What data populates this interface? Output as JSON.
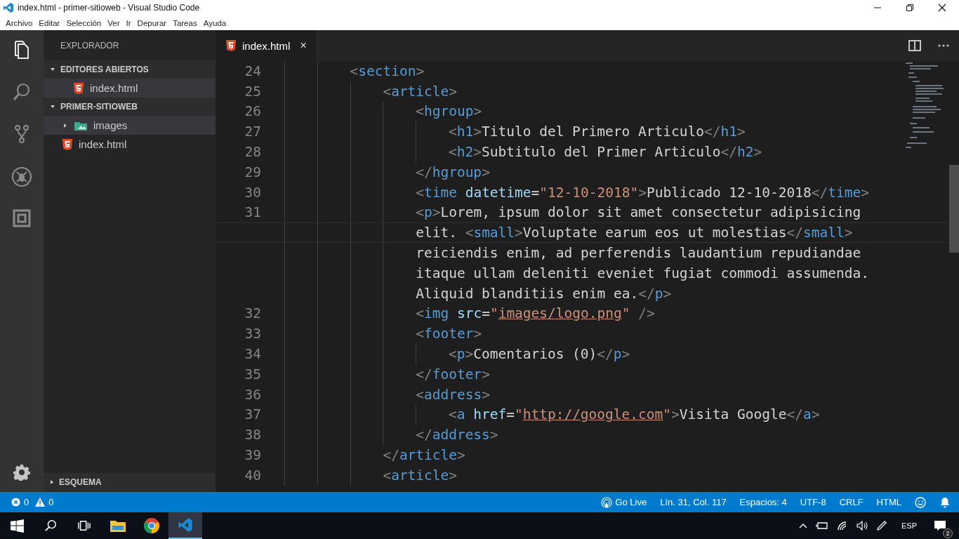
{
  "window": {
    "title": "index.html - primer-sitioweb - Visual Studio Code"
  },
  "menu": [
    "Archivo",
    "Editar",
    "Selección",
    "Ver",
    "Ir",
    "Depurar",
    "Tareas",
    "Ayuda"
  ],
  "activity_bar": [
    {
      "kind": "files",
      "selected": true
    },
    {
      "kind": "search",
      "selected": false
    },
    {
      "kind": "source-control",
      "selected": false
    },
    {
      "kind": "debug",
      "selected": false
    },
    {
      "kind": "extensions",
      "selected": false
    }
  ],
  "sidebar": {
    "title": "EXPLORADOR",
    "sections": [
      {
        "label": "EDITORES ABIERTOS",
        "expanded": true,
        "items": [
          {
            "kind": "html",
            "label": "index.html",
            "selected": true
          }
        ]
      },
      {
        "label": "PRIMER-SITIOWEB",
        "expanded": true,
        "items": [
          {
            "kind": "folder",
            "label": "images",
            "expanded": false,
            "selected": true
          },
          {
            "kind": "html",
            "label": "index.html",
            "selected": false
          }
        ]
      }
    ],
    "outline": {
      "label": "ESQUEMA",
      "expanded": false
    }
  },
  "tabs": [
    {
      "label": "index.html",
      "selected": true,
      "close": "×"
    }
  ],
  "code": {
    "lines": [
      {
        "number": "24",
        "rows": [
          {
            "current": false,
            "tokens": [
              {
                "kind": "punct",
                "text": "<"
              },
              {
                "kind": "tag",
                "text": "section"
              },
              {
                "kind": "punct",
                "text": ">"
              }
            ]
          }
        ],
        "children": [
          {
            "number": "25",
            "rows": [
              {
                "current": false,
                "tokens": [
                  {
                    "kind": "punct",
                    "text": "<"
                  },
                  {
                    "kind": "tag",
                    "text": "article"
                  },
                  {
                    "kind": "punct",
                    "text": ">"
                  }
                ]
              }
            ],
            "children": [
              {
                "number": "26",
                "rows": [
                  {
                    "current": false,
                    "tokens": [
                      {
                        "kind": "punct",
                        "text": "<"
                      },
                      {
                        "kind": "tag",
                        "text": "hgroup"
                      },
                      {
                        "kind": "punct",
                        "text": ">"
                      }
                    ]
                  }
                ],
                "children": [
                  {
                    "number": "27",
                    "rows": [
                      {
                        "current": false,
                        "tokens": [
                          {
                            "kind": "punct",
                            "text": "<"
                          },
                          {
                            "kind": "tag",
                            "text": "h1"
                          },
                          {
                            "kind": "punct",
                            "text": ">"
                          },
                          {
                            "kind": "text",
                            "text": "Titulo del Primero Articulo"
                          },
                          {
                            "kind": "punct",
                            "text": "</"
                          },
                          {
                            "kind": "tag",
                            "text": "h1"
                          },
                          {
                            "kind": "punct",
                            "text": ">"
                          }
                        ]
                      }
                    ]
                  },
                  {
                    "number": "28",
                    "rows": [
                      {
                        "current": false,
                        "tokens": [
                          {
                            "kind": "punct",
                            "text": "<"
                          },
                          {
                            "kind": "tag",
                            "text": "h2"
                          },
                          {
                            "kind": "punct",
                            "text": ">"
                          },
                          {
                            "kind": "text",
                            "text": "Subtitulo del Primer Articulo"
                          },
                          {
                            "kind": "punct",
                            "text": "</"
                          },
                          {
                            "kind": "tag",
                            "text": "h2"
                          },
                          {
                            "kind": "punct",
                            "text": ">"
                          }
                        ]
                      }
                    ]
                  }
                ]
              },
              {
                "number": "29",
                "rows": [
                  {
                    "current": false,
                    "tokens": [
                      {
                        "kind": "punct",
                        "text": "</"
                      },
                      {
                        "kind": "tag",
                        "text": "hgroup"
                      },
                      {
                        "kind": "punct",
                        "text": ">"
                      }
                    ]
                  }
                ]
              },
              {
                "number": "30",
                "rows": [
                  {
                    "current": false,
                    "tokens": [
                      {
                        "kind": "punct",
                        "text": "<"
                      },
                      {
                        "kind": "tag",
                        "text": "time"
                      },
                      {
                        "kind": "attr",
                        "text": " datetime"
                      },
                      {
                        "kind": "text",
                        "text": "="
                      },
                      {
                        "kind": "string",
                        "text": "\"12-10-2018\""
                      },
                      {
                        "kind": "punct",
                        "text": ">"
                      },
                      {
                        "kind": "text",
                        "text": "Publicado 12-10-2018"
                      },
                      {
                        "kind": "punct",
                        "text": "</"
                      },
                      {
                        "kind": "tag",
                        "text": "time"
                      },
                      {
                        "kind": "punct",
                        "text": ">"
                      }
                    ]
                  }
                ]
              },
              {
                "number": "31",
                "rows": [
                  {
                    "current": false,
                    "tokens": [
                      {
                        "kind": "punct",
                        "text": "<"
                      },
                      {
                        "kind": "tag",
                        "text": "p"
                      },
                      {
                        "kind": "punct",
                        "text": ">"
                      },
                      {
                        "kind": "text",
                        "text": "Lorem, ipsum dolor sit amet consectetur adipisicing"
                      }
                    ]
                  },
                  {
                    "current": true,
                    "tokens": [
                      {
                        "kind": "text",
                        "text": "elit. "
                      },
                      {
                        "kind": "punct",
                        "text": "<"
                      },
                      {
                        "kind": "tag",
                        "text": "small"
                      },
                      {
                        "kind": "punct",
                        "text": ">"
                      },
                      {
                        "kind": "text",
                        "text": "Voluptate earum eos ut molestias"
                      },
                      {
                        "kind": "punct",
                        "text": "</"
                      },
                      {
                        "kind": "tag",
                        "text": "small"
                      },
                      {
                        "kind": "punct",
                        "text": ">"
                      }
                    ]
                  },
                  {
                    "current": false,
                    "tokens": [
                      {
                        "kind": "text",
                        "text": "reiciendis enim, ad perferendis laudantium repudiandae"
                      }
                    ]
                  },
                  {
                    "current": false,
                    "tokens": [
                      {
                        "kind": "text",
                        "text": "itaque ullam deleniti eveniet fugiat commodi assumenda."
                      }
                    ]
                  },
                  {
                    "current": false,
                    "tokens": [
                      {
                        "kind": "text",
                        "text": "Aliquid blanditiis enim ea."
                      },
                      {
                        "kind": "punct",
                        "text": "</"
                      },
                      {
                        "kind": "tag",
                        "text": "p"
                      },
                      {
                        "kind": "punct",
                        "text": ">"
                      }
                    ]
                  }
                ]
              },
              {
                "number": "32",
                "rows": [
                  {
                    "current": false,
                    "tokens": [
                      {
                        "kind": "punct",
                        "text": "<"
                      },
                      {
                        "kind": "tag",
                        "text": "img"
                      },
                      {
                        "kind": "attr",
                        "text": " src"
                      },
                      {
                        "kind": "text",
                        "text": "="
                      },
                      {
                        "kind": "string",
                        "text": "\""
                      },
                      {
                        "kind": "link",
                        "text": "images/logo.png"
                      },
                      {
                        "kind": "string",
                        "text": "\""
                      },
                      {
                        "kind": "punct",
                        "text": " />"
                      }
                    ]
                  }
                ]
              },
              {
                "number": "33",
                "rows": [
                  {
                    "current": false,
                    "tokens": [
                      {
                        "kind": "punct",
                        "text": "<"
                      },
                      {
                        "kind": "tag",
                        "text": "footer"
                      },
                      {
                        "kind": "punct",
                        "text": ">"
                      }
                    ]
                  }
                ],
                "children": [
                  {
                    "number": "34",
                    "rows": [
                      {
                        "current": false,
                        "tokens": [
                          {
                            "kind": "punct",
                            "text": "<"
                          },
                          {
                            "kind": "tag",
                            "text": "p"
                          },
                          {
                            "kind": "punct",
                            "text": ">"
                          },
                          {
                            "kind": "text",
                            "text": "Comentarios (0)"
                          },
                          {
                            "kind": "punct",
                            "text": "</"
                          },
                          {
                            "kind": "tag",
                            "text": "p"
                          },
                          {
                            "kind": "punct",
                            "text": ">"
                          }
                        ]
                      }
                    ]
                  }
                ]
              },
              {
                "number": "35",
                "rows": [
                  {
                    "current": false,
                    "tokens": [
                      {
                        "kind": "punct",
                        "text": "</"
                      },
                      {
                        "kind": "tag",
                        "text": "footer"
                      },
                      {
                        "kind": "punct",
                        "text": ">"
                      }
                    ]
                  }
                ]
              },
              {
                "number": "36",
                "rows": [
                  {
                    "current": false,
                    "tokens": [
                      {
                        "kind": "punct",
                        "text": "<"
                      },
                      {
                        "kind": "tag",
                        "text": "address"
                      },
                      {
                        "kind": "punct",
                        "text": ">"
                      }
                    ]
                  }
                ],
                "children": [
                  {
                    "number": "37",
                    "rows": [
                      {
                        "current": false,
                        "tokens": [
                          {
                            "kind": "punct",
                            "text": "<"
                          },
                          {
                            "kind": "tag",
                            "text": "a"
                          },
                          {
                            "kind": "attr",
                            "text": " href"
                          },
                          {
                            "kind": "text",
                            "text": "="
                          },
                          {
                            "kind": "string",
                            "text": "\""
                          },
                          {
                            "kind": "link",
                            "text": "http://google.com"
                          },
                          {
                            "kind": "string",
                            "text": "\""
                          },
                          {
                            "kind": "punct",
                            "text": ">"
                          },
                          {
                            "kind": "text",
                            "text": "Visita Google"
                          },
                          {
                            "kind": "punct",
                            "text": "</"
                          },
                          {
                            "kind": "tag",
                            "text": "a"
                          },
                          {
                            "kind": "punct",
                            "text": ">"
                          }
                        ]
                      }
                    ]
                  }
                ]
              },
              {
                "number": "38",
                "rows": [
                  {
                    "current": false,
                    "tokens": [
                      {
                        "kind": "punct",
                        "text": "</"
                      },
                      {
                        "kind": "tag",
                        "text": "address"
                      },
                      {
                        "kind": "punct",
                        "text": ">"
                      }
                    ]
                  }
                ]
              }
            ]
          },
          {
            "number": "39",
            "rows": [
              {
                "current": false,
                "tokens": [
                  {
                    "kind": "punct",
                    "text": "</"
                  },
                  {
                    "kind": "tag",
                    "text": "article"
                  },
                  {
                    "kind": "punct",
                    "text": ">"
                  }
                ]
              }
            ]
          },
          {
            "number": "40",
            "rows": [
              {
                "current": false,
                "tokens": [
                  {
                    "kind": "punct",
                    "text": "<"
                  },
                  {
                    "kind": "tag",
                    "text": "article"
                  },
                  {
                    "kind": "punct",
                    "text": ">"
                  }
                ]
              }
            ]
          }
        ]
      }
    ]
  },
  "status_bar": {
    "errors": "0",
    "warnings": "0",
    "items": [
      {
        "kind": "live",
        "label": "Go Live"
      },
      {
        "kind": "text",
        "label": "Lín. 31, Col. 117"
      },
      {
        "kind": "text",
        "label": "Espacios: 4"
      },
      {
        "kind": "text",
        "label": "UTF-8"
      },
      {
        "kind": "text",
        "label": "CRLF"
      },
      {
        "kind": "text",
        "label": "HTML"
      },
      {
        "kind": "smiley"
      },
      {
        "kind": "bell"
      }
    ]
  },
  "taskbar": {
    "apps": [
      {
        "kind": "start",
        "selected": false
      },
      {
        "kind": "search",
        "selected": false
      },
      {
        "kind": "taskview",
        "selected": false
      },
      {
        "kind": "folder",
        "selected": false
      },
      {
        "kind": "chrome",
        "selected": false
      },
      {
        "kind": "vscode",
        "selected": true
      }
    ],
    "tray": {
      "language": "ESP",
      "notifications": "2"
    }
  }
}
